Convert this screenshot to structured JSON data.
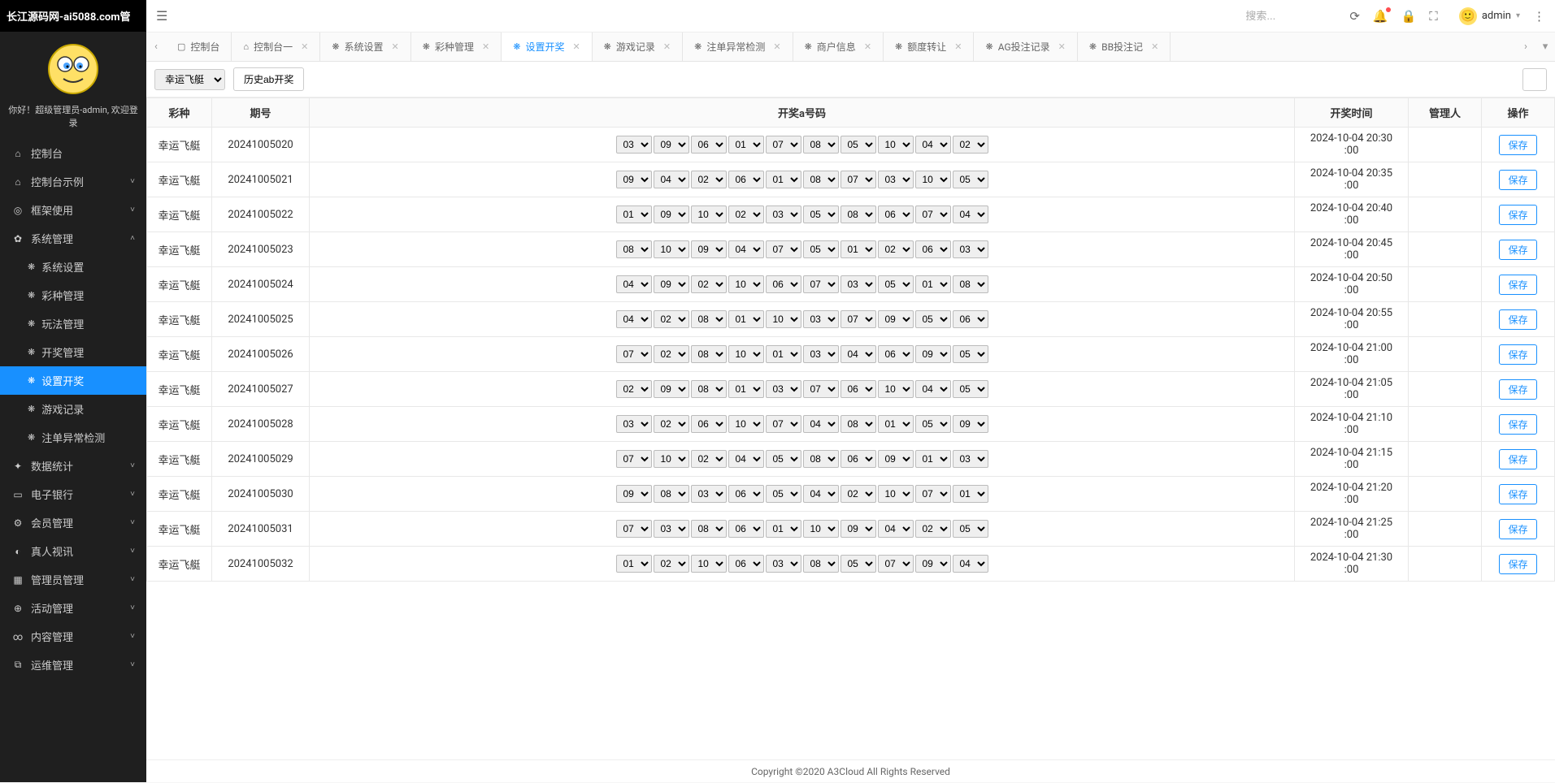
{
  "app_title": "长江源码网-ai5088.com管",
  "welcome": "你好！超级管理员-admin, 欢迎登录",
  "search_placeholder": "搜索...",
  "user_name": "admin",
  "sidebar": {
    "menu": [
      {
        "icon": "⌂",
        "label": "控制台",
        "expandable": false
      },
      {
        "icon": "⌂",
        "label": "控制台示例",
        "expandable": true
      },
      {
        "icon": "◎",
        "label": "框架使用",
        "expandable": true
      },
      {
        "icon": "✿",
        "label": "系统管理",
        "expandable": true,
        "open": true,
        "children": [
          {
            "icon": "❋",
            "label": "系统设置"
          },
          {
            "icon": "❋",
            "label": "彩种管理"
          },
          {
            "icon": "❋",
            "label": "玩法管理"
          },
          {
            "icon": "❋",
            "label": "开奖管理"
          },
          {
            "icon": "❋",
            "label": "设置开奖",
            "active": true
          },
          {
            "icon": "❋",
            "label": "游戏记录"
          },
          {
            "icon": "❋",
            "label": "注单异常检测"
          }
        ]
      },
      {
        "icon": "✦",
        "label": "数据统计",
        "expandable": true
      },
      {
        "icon": "▭",
        "label": "电子银行",
        "expandable": true
      },
      {
        "icon": "⚙",
        "label": "会员管理",
        "expandable": true
      },
      {
        "icon": "◐",
        "label": "真人视讯",
        "expandable": true
      },
      {
        "icon": "▦",
        "label": "管理员管理",
        "expandable": true
      },
      {
        "icon": "⊕",
        "label": "活动管理",
        "expandable": true
      },
      {
        "icon": "∞",
        "label": "内容管理",
        "expandable": true
      },
      {
        "icon": "⧉",
        "label": "运维管理",
        "expandable": true
      }
    ]
  },
  "tabs": [
    {
      "icon": "▢",
      "label": "控制台",
      "closable": false
    },
    {
      "icon": "⌂",
      "label": "控制台一",
      "closable": true
    },
    {
      "icon": "❋",
      "label": "系统设置",
      "closable": true
    },
    {
      "icon": "❋",
      "label": "彩种管理",
      "closable": true
    },
    {
      "icon": "❋",
      "label": "设置开奖",
      "closable": true,
      "active": true
    },
    {
      "icon": "❋",
      "label": "游戏记录",
      "closable": true
    },
    {
      "icon": "❋",
      "label": "注单异常检测",
      "closable": true
    },
    {
      "icon": "❋",
      "label": "商户信息",
      "closable": true
    },
    {
      "icon": "❋",
      "label": "额度转让",
      "closable": true
    },
    {
      "icon": "❋",
      "label": "AG投注记录",
      "closable": true
    },
    {
      "icon": "❋",
      "label": "BB投注记",
      "closable": true
    }
  ],
  "toolbar": {
    "lottery_options": [
      "幸运飞艇"
    ],
    "lottery_selected": "幸运飞艇",
    "history_label": "历史ab开奖"
  },
  "columns": {
    "c1": "彩种",
    "c2": "期号",
    "c3": "开奖a号码",
    "c4": "开奖时间",
    "c5": "管理人",
    "c6": "操作"
  },
  "save_label": "保存",
  "rows": [
    {
      "name": "幸运飞艇",
      "period": "20241005020",
      "nums": [
        "03",
        "09",
        "06",
        "01",
        "07",
        "08",
        "05",
        "10",
        "04",
        "02"
      ],
      "time": "2024-10-04 20:30:00",
      "admin": ""
    },
    {
      "name": "幸运飞艇",
      "period": "20241005021",
      "nums": [
        "09",
        "04",
        "02",
        "06",
        "01",
        "08",
        "07",
        "03",
        "10",
        "05"
      ],
      "time": "2024-10-04 20:35:00",
      "admin": ""
    },
    {
      "name": "幸运飞艇",
      "period": "20241005022",
      "nums": [
        "01",
        "09",
        "10",
        "02",
        "03",
        "05",
        "08",
        "06",
        "07",
        "04"
      ],
      "time": "2024-10-04 20:40:00",
      "admin": ""
    },
    {
      "name": "幸运飞艇",
      "period": "20241005023",
      "nums": [
        "08",
        "10",
        "09",
        "04",
        "07",
        "05",
        "01",
        "02",
        "06",
        "03"
      ],
      "time": "2024-10-04 20:45:00",
      "admin": ""
    },
    {
      "name": "幸运飞艇",
      "period": "20241005024",
      "nums": [
        "04",
        "09",
        "02",
        "10",
        "06",
        "07",
        "03",
        "05",
        "01",
        "08"
      ],
      "time": "2024-10-04 20:50:00",
      "admin": ""
    },
    {
      "name": "幸运飞艇",
      "period": "20241005025",
      "nums": [
        "04",
        "02",
        "08",
        "01",
        "10",
        "03",
        "07",
        "09",
        "05",
        "06"
      ],
      "time": "2024-10-04 20:55:00",
      "admin": ""
    },
    {
      "name": "幸运飞艇",
      "period": "20241005026",
      "nums": [
        "07",
        "02",
        "08",
        "10",
        "01",
        "03",
        "04",
        "06",
        "09",
        "05"
      ],
      "time": "2024-10-04 21:00:00",
      "admin": ""
    },
    {
      "name": "幸运飞艇",
      "period": "20241005027",
      "nums": [
        "02",
        "09",
        "08",
        "01",
        "03",
        "07",
        "06",
        "10",
        "04",
        "05"
      ],
      "time": "2024-10-04 21:05:00",
      "admin": ""
    },
    {
      "name": "幸运飞艇",
      "period": "20241005028",
      "nums": [
        "03",
        "02",
        "06",
        "10",
        "07",
        "04",
        "08",
        "01",
        "05",
        "09"
      ],
      "time": "2024-10-04 21:10:00",
      "admin": ""
    },
    {
      "name": "幸运飞艇",
      "period": "20241005029",
      "nums": [
        "07",
        "10",
        "02",
        "04",
        "05",
        "08",
        "06",
        "09",
        "01",
        "03"
      ],
      "time": "2024-10-04 21:15:00",
      "admin": ""
    },
    {
      "name": "幸运飞艇",
      "period": "20241005030",
      "nums": [
        "09",
        "08",
        "03",
        "06",
        "05",
        "04",
        "02",
        "10",
        "07",
        "01"
      ],
      "time": "2024-10-04 21:20:00",
      "admin": ""
    },
    {
      "name": "幸运飞艇",
      "period": "20241005031",
      "nums": [
        "07",
        "03",
        "08",
        "06",
        "01",
        "10",
        "09",
        "04",
        "02",
        "05"
      ],
      "time": "2024-10-04 21:25:00",
      "admin": ""
    },
    {
      "name": "幸运飞艇",
      "period": "20241005032",
      "nums": [
        "01",
        "02",
        "10",
        "06",
        "03",
        "08",
        "05",
        "07",
        "09",
        "04"
      ],
      "time": "2024-10-04 21:30:00",
      "admin": ""
    }
  ],
  "footer": "Copyright ©2020 A3Cloud All Rights Reserved"
}
